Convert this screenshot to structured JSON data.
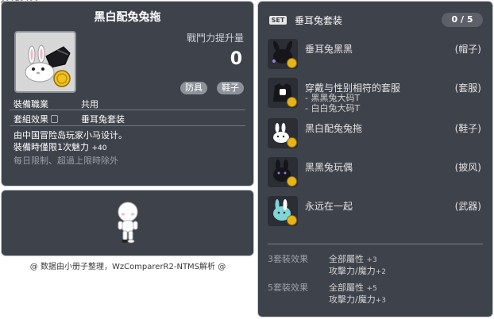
{
  "item_id": "01073496",
  "item": {
    "name": "黑白配兔兔拖",
    "attack_label": "戰鬥力提升量",
    "attack_value": "0",
    "tags": [
      "防具",
      "鞋子"
    ],
    "job_label": "裝備職業",
    "job_value": "共用",
    "set_label": "套組效果",
    "set_value": "垂耳兔套装",
    "desc_line1": "由中国冒险岛玩家小马设计。",
    "desc_line2_main": "裝備時僅限1次魅力",
    "desc_line2_bonus": "+40",
    "desc_line3": "每日限制、超過上限時除外"
  },
  "footer": "@ 数据由小册子整理，WzComparerR2-NTMS解析 @",
  "set_panel": {
    "badge": "SET",
    "name": "垂耳兔套装",
    "count": "0 / 5",
    "pieces": [
      {
        "name": "垂耳兔黑黑",
        "type": "(帽子)"
      },
      {
        "name": "穿戴与性别相符的套服",
        "type": "(套服)",
        "subs": [
          "- 黑黑兔大码T",
          "- 白白兔大码T"
        ]
      },
      {
        "name": "黑白配兔兔拖",
        "type": "(鞋子)"
      },
      {
        "name": "黑黑兔玩偶",
        "type": "(披风)"
      },
      {
        "name": "永远在一起",
        "type": "(武器)"
      }
    ],
    "bonuses": [
      {
        "label": "3套裝效果",
        "line1": "全部屬性",
        "line1_val": "+3",
        "line2": "攻擊力/魔力",
        "line2_val": "+2"
      },
      {
        "label": "5套裝效果",
        "line1": "全部屬性",
        "line1_val": "+5",
        "line2": "攻擊力/魔力",
        "line2_val": "+3"
      }
    ]
  }
}
